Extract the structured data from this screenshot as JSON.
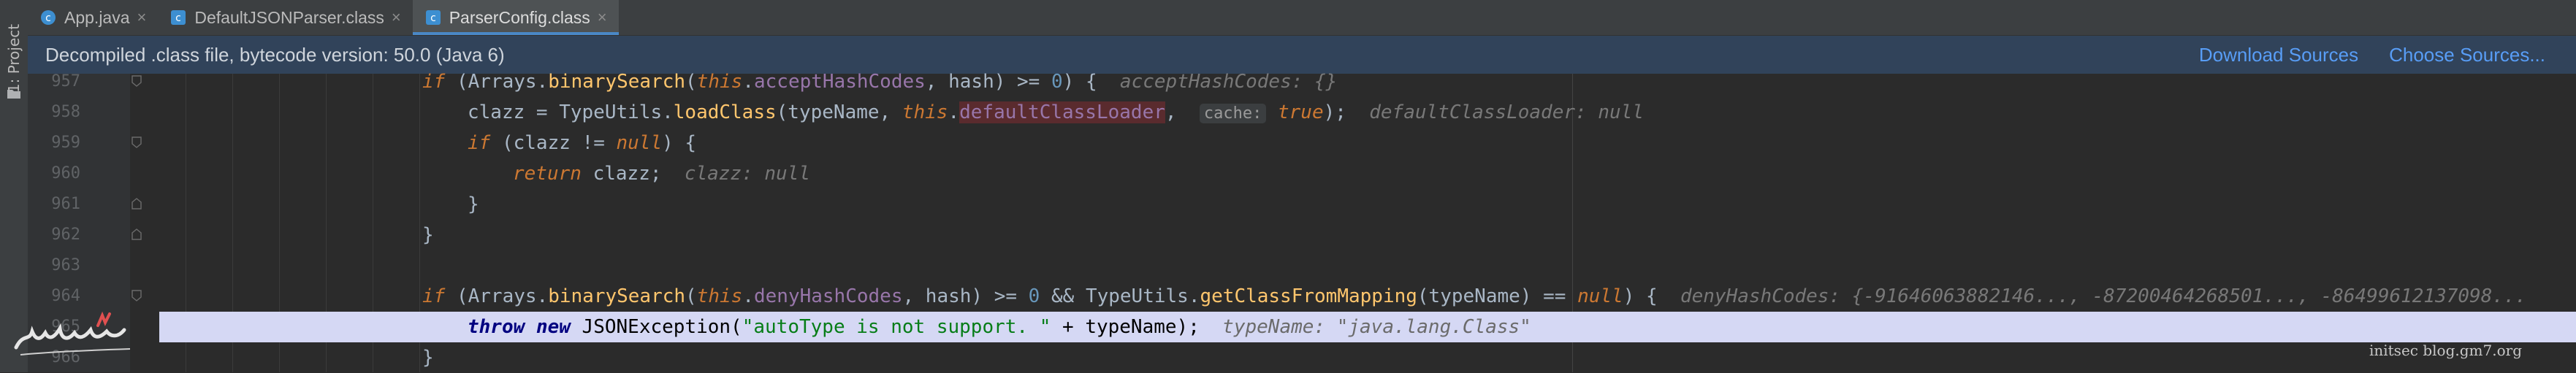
{
  "sidebar": {
    "project_label": "1: Project"
  },
  "tabs": [
    {
      "label": "App.java",
      "active": false
    },
    {
      "label": "DefaultJSONParser.class",
      "active": false
    },
    {
      "label": "ParserConfig.class",
      "active": true
    }
  ],
  "infobar": {
    "message": "Decompiled .class file, bytecode version: 50.0 (Java 6)",
    "download_sources": "Download Sources",
    "choose_sources": "Choose Sources..."
  },
  "editor": {
    "lines": [
      {
        "num": "957"
      },
      {
        "num": "958"
      },
      {
        "num": "959"
      },
      {
        "num": "960"
      },
      {
        "num": "961"
      },
      {
        "num": "962"
      },
      {
        "num": "963"
      },
      {
        "num": "964"
      },
      {
        "num": "965"
      },
      {
        "num": "966"
      }
    ],
    "code": {
      "l957": {
        "kw_if": "if",
        "p1": " (Arrays.",
        "m1": "binarySearch",
        "p2": "(",
        "kw_this": "this",
        "p3": ".",
        "f1": "acceptHashCodes",
        "p4": ", hash) >= ",
        "n1": "0",
        "p5": ") {",
        "hint": "acceptHashCodes: {}"
      },
      "l958": {
        "p1": "clazz = TypeUtils.",
        "m1": "loadClass",
        "p2": "(typeName, ",
        "kw_this": "this",
        "p3": ".",
        "f1": "defaultClassLoader",
        "p4": ", ",
        "param": "cache:",
        "kw_true": "true",
        "p5": ");",
        "hint": "defaultClassLoader: null"
      },
      "l959": {
        "kw_if": "if",
        "p1": " (clazz != ",
        "kw_null": "null",
        "p2": ") {"
      },
      "l960": {
        "kw_return": "return",
        "p1": " clazz;",
        "hint": "clazz: null"
      },
      "l961": {
        "p1": "}"
      },
      "l962": {
        "p1": "}"
      },
      "l964": {
        "kw_if": "if",
        "p1": " (Arrays.",
        "m1": "binarySearch",
        "p2": "(",
        "kw_this": "this",
        "p3": ".",
        "f1": "denyHashCodes",
        "p4": ", hash) >= ",
        "n1": "0",
        "p5": " && TypeUtils.",
        "m2": "getClassFromMapping",
        "p6": "(typeName) == ",
        "kw_null": "null",
        "p7": ") {",
        "hint": "denyHashCodes: {-91646063882146..., -87200464268501..., -86499612137098..."
      },
      "l965": {
        "kw_throw": "throw",
        "sp1": " ",
        "kw_new": "new",
        "p1": " JSONException(",
        "s1": "\"autoType is not support. \"",
        "p2": " + typeName);",
        "hint": "typeName: \"java.lang.Class\""
      },
      "l966": {
        "p1": "}"
      }
    }
  },
  "watermark": {
    "text": "initsec blog.gm7.org"
  },
  "colors": {
    "accent": "#4a88c7",
    "link": "#589df6",
    "selection": "#d5d8f4",
    "infobar": "#31435a"
  }
}
